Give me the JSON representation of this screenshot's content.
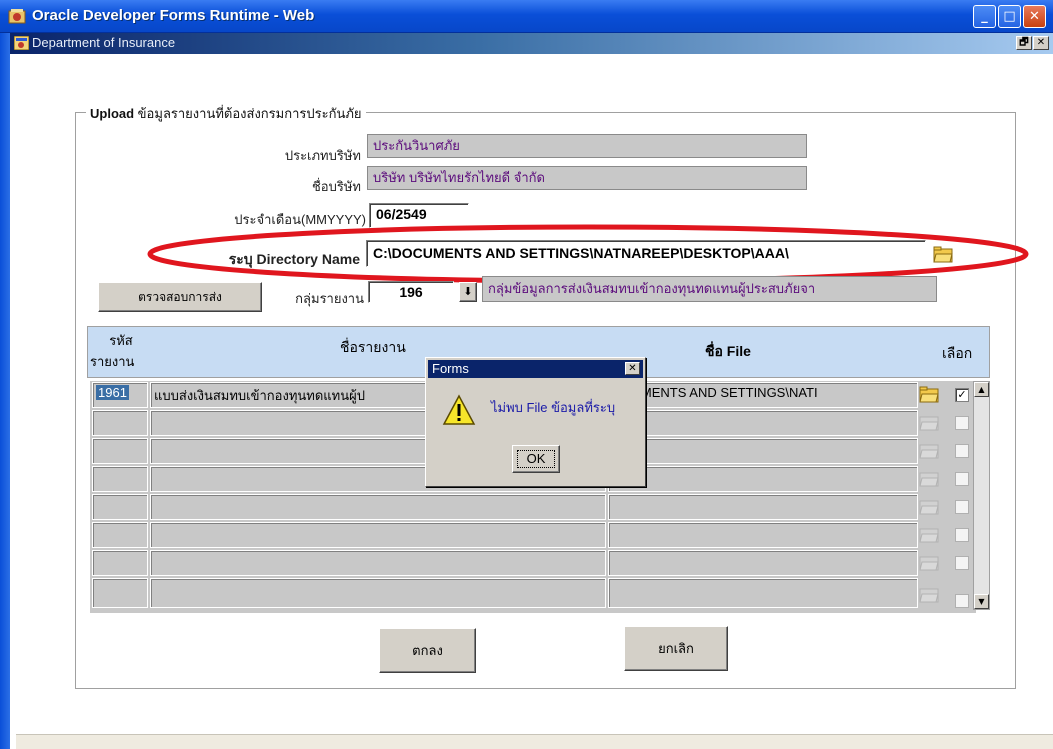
{
  "window": {
    "title": "Oracle Developer Forms Runtime - Web",
    "minimize": "_",
    "maximize": "□",
    "close": "✕"
  },
  "mdi": {
    "title": "Department of Insurance",
    "restore": "🗗",
    "close": "✕"
  },
  "form": {
    "group_title_bold": "Upload",
    "group_title_rest": " ข้อมูลรายงานที่ต้องส่งกรมการประกันภัย",
    "company_type_label": "ประเภทบริษัท",
    "company_type_value": "ประกันวินาศภัย",
    "company_name_label": "ชื่อบริษัท",
    "company_name_value": "บริษัท บริษัทไทยรักไทยดี จำกัด",
    "month_label": "ประจำเดือน(MMYYYY)",
    "month_value": "06/2549",
    "dir_label": "ระบุ Directory Name",
    "dir_value": "C:\\DOCUMENTS AND SETTINGS\\NATNAREEP\\DESKTOP\\AAA\\",
    "check_button": "ตรวจสอบการส่ง",
    "report_group_label": "กลุ่มรายงาน",
    "report_group_value": "196",
    "report_group_desc": "กลุ่มข้อมูลการส่งเงินสมทบเข้ากองทุนทดแทนผู้ประสบภัยจา"
  },
  "grid": {
    "col_code": "รหัสรายงาน",
    "col_code_1": "รหัส",
    "col_code_2": "รายงาน",
    "col_name": "ชื่อรายงาน",
    "col_file": "ชื่อ File",
    "col_select": "เลือก",
    "rows": [
      {
        "code": "1961",
        "name": "แบบส่งเงินสมทบเข้ากองทุนทดแทนผู้ป",
        "file": "OCUMENTS AND SETTINGS\\NATI",
        "checked": "✓"
      }
    ]
  },
  "buttons": {
    "ok": "ตกลง",
    "cancel": "ยกเลิก"
  },
  "dialog": {
    "title": "Forms",
    "message": "ไม่พบ File ข้อมูลที่ระบุ",
    "ok": "OK",
    "close": "✕",
    "icon": "warning-icon"
  },
  "colors": {
    "accent": "#0a4fd8",
    "header_bg": "#c7dcf3",
    "annotation": "#e0161e"
  }
}
